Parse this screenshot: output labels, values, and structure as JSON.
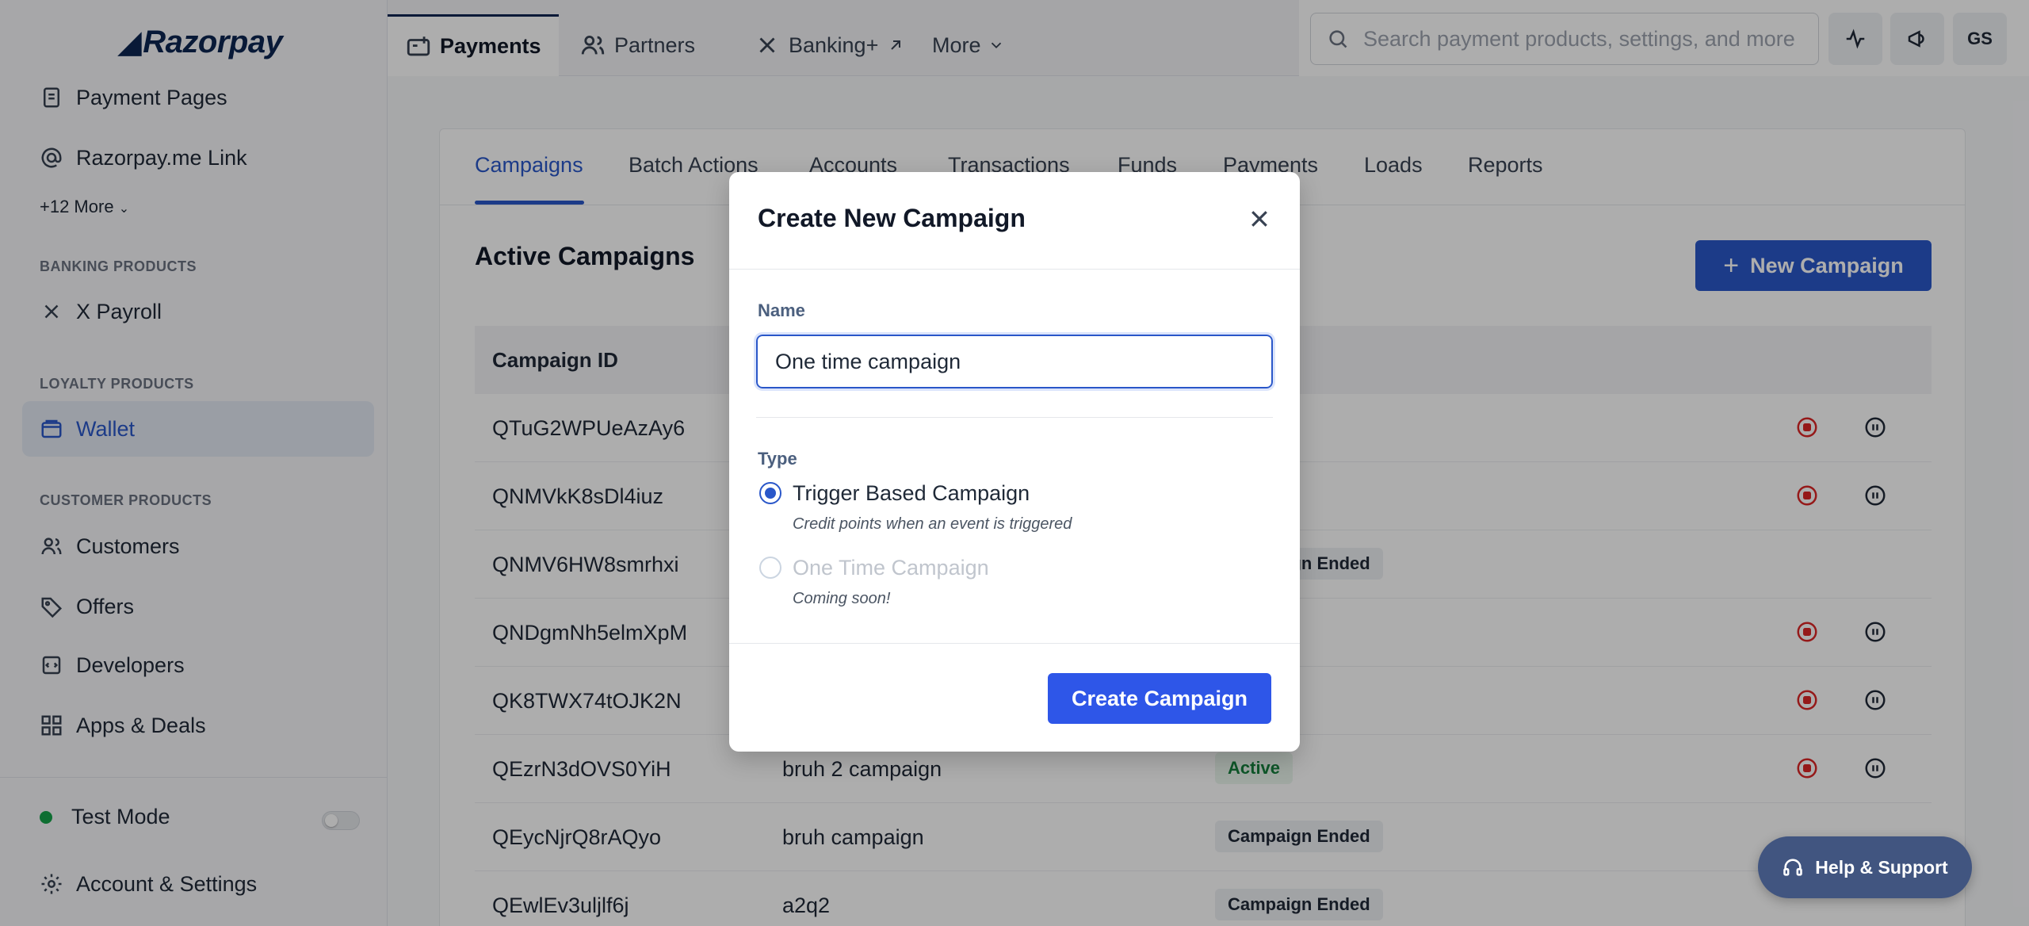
{
  "brand": {
    "logo": "Razorpay"
  },
  "sidebar": {
    "items": [
      {
        "label": "Payment Pages",
        "icon": "page-icon"
      },
      {
        "label": "Razorpay.me Link",
        "icon": "at-icon"
      },
      {
        "label": "X Payroll",
        "icon": "x-icon"
      },
      {
        "label": "Wallet",
        "icon": "wallet-icon"
      },
      {
        "label": "Customers",
        "icon": "users-icon"
      },
      {
        "label": "Offers",
        "icon": "tag-icon"
      },
      {
        "label": "Developers",
        "icon": "code-icon"
      },
      {
        "label": "Apps & Deals",
        "icon": "apps-icon"
      }
    ],
    "more_label": "+12 More",
    "sections": {
      "banking": "BANKING PRODUCTS",
      "loyalty": "LOYALTY PRODUCTS",
      "customer": "CUSTOMER PRODUCTS"
    },
    "test_mode": "Test Mode",
    "account": "Account & Settings"
  },
  "topnav": {
    "tabs": [
      "Payments",
      "Partners",
      "Banking+",
      "More"
    ],
    "search_placeholder": "Search payment products, settings, and more",
    "avatar": "GS"
  },
  "main": {
    "tabs": [
      "Campaigns",
      "Batch Actions",
      "Accounts",
      "Transactions",
      "Funds",
      "Payments",
      "Loads",
      "Reports"
    ],
    "title": "Active Campaigns",
    "new_button": "New Campaign",
    "table": {
      "header": "Campaign ID",
      "rows": [
        {
          "id": "QTuG2WPUeAzAy6",
          "name": "",
          "status": ""
        },
        {
          "id": "QNMVkK8sDl4iuz",
          "name": "",
          "status": ""
        },
        {
          "id": "QNMV6HW8smrhxi",
          "name": "",
          "status": "Campaign Ended"
        },
        {
          "id": "QNDgmNh5elmXpM",
          "name": "",
          "status": ""
        },
        {
          "id": "QK8TWX74tOJK2N",
          "name": "",
          "status": ""
        },
        {
          "id": "QEzrN3dOVS0YiH",
          "name": "bruh 2 campaign",
          "status": "Active"
        },
        {
          "id": "QEycNjrQ8rAQyo",
          "name": "bruh campaign",
          "status": "Campaign Ended"
        },
        {
          "id": "QEwlEv3uljlf6j",
          "name": "a2q2",
          "status": "Campaign Ended"
        }
      ]
    }
  },
  "modal": {
    "title": "Create New Campaign",
    "name_label": "Name",
    "name_value": "One time campaign",
    "type_label": "Type",
    "option1": "Trigger Based Campaign",
    "option1_help": "Credit points when an event is triggered",
    "option2": "One Time Campaign",
    "option2_help": "Coming soon!",
    "submit": "Create Campaign"
  },
  "help": {
    "label": "Help & Support"
  }
}
